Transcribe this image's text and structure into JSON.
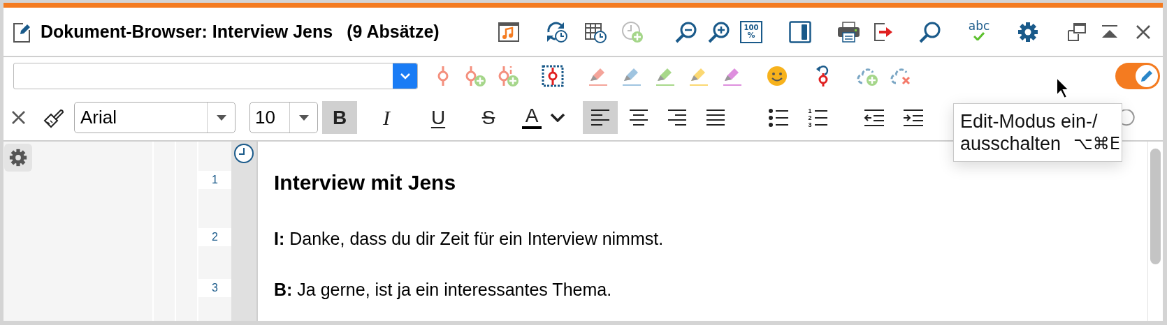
{
  "window": {
    "title": "Dokument-Browser: Interview Jens",
    "count": "(9 Absätze)",
    "zoom_reset_icon_text": [
      "100",
      "%"
    ],
    "spellcheck_icon_text": "abc"
  },
  "edit_mode": {
    "on": true
  },
  "format_bar": {
    "font": "Arial",
    "size": "10",
    "style_buttons": [
      {
        "kind": "bold",
        "glyph": "B",
        "selected": true
      },
      {
        "kind": "italic",
        "glyph": "I",
        "selected": false
      },
      {
        "kind": "underline",
        "glyph": "U",
        "selected": false
      },
      {
        "kind": "strikethrough",
        "glyph": "S",
        "selected": false
      }
    ],
    "font_color_glyph": "A",
    "align_buttons": [
      {
        "kind": "left",
        "selected": true
      },
      {
        "kind": "center",
        "selected": false
      },
      {
        "kind": "right",
        "selected": false
      },
      {
        "kind": "justify",
        "selected": false
      }
    ],
    "numbered_list_icon_digits": [
      "1",
      "2",
      "3"
    ]
  },
  "tooltip": {
    "lines": [
      "Edit-Modus ein-/",
      "ausschalten"
    ],
    "shortcut": "⌥⌘E"
  },
  "paragraphs": [
    {
      "number": "1",
      "kind": "heading",
      "text": "Interview mit Jens"
    },
    {
      "number": "2",
      "kind": "body",
      "text": "**I:** Danke, dass du dir Zeit für ein Interview nimmst."
    },
    {
      "number": "3",
      "kind": "body",
      "text": "**B:** Ja gerne, ist ja ein interessantes Thema."
    }
  ]
}
